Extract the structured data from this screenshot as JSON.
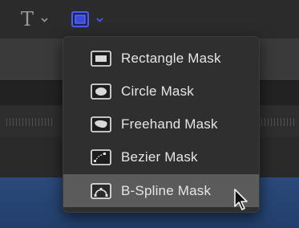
{
  "toolbar": {
    "text_tool": {
      "glyph": "T",
      "icon": "text-tool-icon"
    },
    "mask_tool": {
      "icon": "mask-tool-icon",
      "active_color": "#4a5cff"
    }
  },
  "mask_menu": {
    "items": [
      {
        "label": "Rectangle Mask",
        "icon": "rectangle-mask-icon",
        "selected": false
      },
      {
        "label": "Circle Mask",
        "icon": "circle-mask-icon",
        "selected": false
      },
      {
        "label": "Freehand Mask",
        "icon": "freehand-mask-icon",
        "selected": false
      },
      {
        "label": "Bezier Mask",
        "icon": "bezier-mask-icon",
        "selected": false
      },
      {
        "label": "B-Spline Mask",
        "icon": "bspline-mask-icon",
        "selected": true
      }
    ]
  },
  "colors": {
    "menu_background": "#2f2f2f",
    "selected_background": "#5b5b5b",
    "text": "#e6e6e6",
    "timeline_blue": "#2a4a7a"
  }
}
